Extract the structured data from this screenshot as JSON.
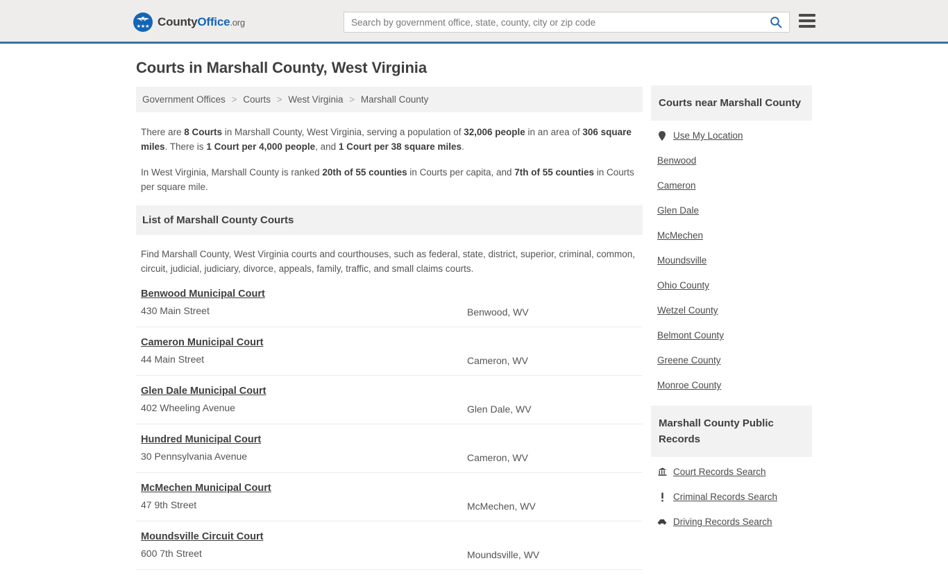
{
  "header": {
    "logo_name": "County",
    "logo_name_bold": "Office",
    "logo_tld": ".org",
    "logo_stars": "★★★",
    "search_placeholder": "Search by government office, state, county, city or zip code",
    "search_value": "",
    "search_icon": "search-icon",
    "menu_icon": "hamburger-menu-icon",
    "accent_color": "#3a6ea5",
    "logo_color": "#1565b5"
  },
  "main": {
    "title": "Courts in Marshall County, West Virginia",
    "breadcrumb": [
      "Government Offices",
      "Courts",
      "West Virginia",
      "Marshall County"
    ],
    "breadcrumb_separator": ">",
    "intro": {
      "p1_part1": "There are ",
      "p1_b1": "8 Courts",
      "p1_part2": " in Marshall County, West Virginia, serving a population of ",
      "p1_b2": "32,006 people",
      "p1_part3": " in an area of ",
      "p1_b3": "306 square miles",
      "p1_part4": ". There is ",
      "p1_b4": "1 Court per 4,000 people",
      "p1_part5": ", and ",
      "p1_b5": "1 Court per 38 square miles",
      "p1_part6": ".",
      "p2_part1": "In West Virginia, Marshall County is ranked ",
      "p2_b1": "20th of 55 counties",
      "p2_part2": " in Courts per capita, and ",
      "p2_b2": "7th of 55 counties",
      "p2_part3": " in Courts per square mile."
    },
    "list_heading": "List of Marshall County Courts",
    "list_description": "Find Marshall County, West Virginia courts and courthouses, such as federal, state, district, superior, criminal, common, circuit, judicial, judiciary, divorce, appeals, family, traffic, and small claims courts.",
    "courts": [
      {
        "name": "Benwood Municipal Court",
        "address": "430 Main Street",
        "city": "Benwood, WV"
      },
      {
        "name": "Cameron Municipal Court",
        "address": "44 Main Street",
        "city": "Cameron, WV"
      },
      {
        "name": "Glen Dale Municipal Court",
        "address": "402 Wheeling Avenue",
        "city": "Glen Dale, WV"
      },
      {
        "name": "Hundred Municipal Court",
        "address": "30 Pennsylvania Avenue",
        "city": "Cameron, WV"
      },
      {
        "name": "McMechen Municipal Court",
        "address": "47 9th Street",
        "city": "McMechen, WV"
      },
      {
        "name": "Moundsville Circuit Court",
        "address": "600 7th Street",
        "city": "Moundsville, WV"
      }
    ]
  },
  "sidebar": {
    "nearby": {
      "heading": "Courts near Marshall County",
      "use_my_location": "Use My Location",
      "location_icon": "map-pin-icon",
      "links": [
        "Benwood",
        "Cameron",
        "Glen Dale",
        "McMechen",
        "Moundsville",
        "Ohio County",
        "Wetzel County",
        "Belmont County",
        "Greene County",
        "Monroe County"
      ]
    },
    "records": {
      "heading": "Marshall County Public Records",
      "links": [
        {
          "label": "Court Records Search",
          "icon": "courthouse-icon"
        },
        {
          "label": "Criminal Records Search",
          "icon": "exclamation-icon"
        },
        {
          "label": "Driving Records Search",
          "icon": "car-icon"
        }
      ]
    }
  }
}
